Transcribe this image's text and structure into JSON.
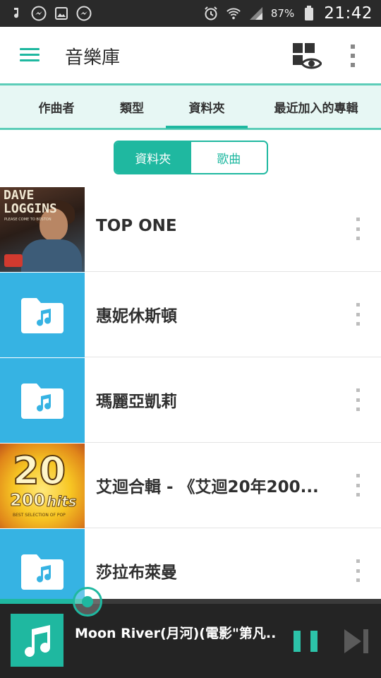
{
  "status_bar": {
    "battery": "87%",
    "time": "21:42"
  },
  "app_bar": {
    "title": "音樂庫"
  },
  "tabs": [
    {
      "label": "作曲者"
    },
    {
      "label": "類型"
    },
    {
      "label": "資料夾",
      "active": true
    },
    {
      "label": "最近加入的專輯"
    }
  ],
  "segment": {
    "left_label": "資料夾",
    "right_label": "歌曲",
    "active": "資料夾"
  },
  "list": [
    {
      "title": "TOP ONE",
      "art": "album-cover"
    },
    {
      "title": "惠妮休斯頓",
      "art": "folder-icon"
    },
    {
      "title": "瑪麗亞凱莉",
      "art": "folder-icon"
    },
    {
      "title": "艾迴合輯 - 《艾迴20年200...",
      "art": "album-cover"
    },
    {
      "title": "莎拉布萊曼",
      "art": "folder-icon"
    }
  ],
  "album_art": {
    "dave": {
      "line1": "DAVE",
      "line2": "LOGGINS",
      "line3": "PLEASE COME TO BOSTON"
    },
    "twenty": {
      "big": "20",
      "mid": "200",
      "hits": "hits",
      "tiny": "BEST SELECTION OF POP"
    }
  },
  "player": {
    "title": "Moon River(月河)(電影\"第凡..",
    "progress": 0.23
  },
  "colors": {
    "accent": "#1fb8a0",
    "folder": "#36b3e3",
    "status_bar": "#2a2a2a",
    "player_bg": "#242424"
  }
}
